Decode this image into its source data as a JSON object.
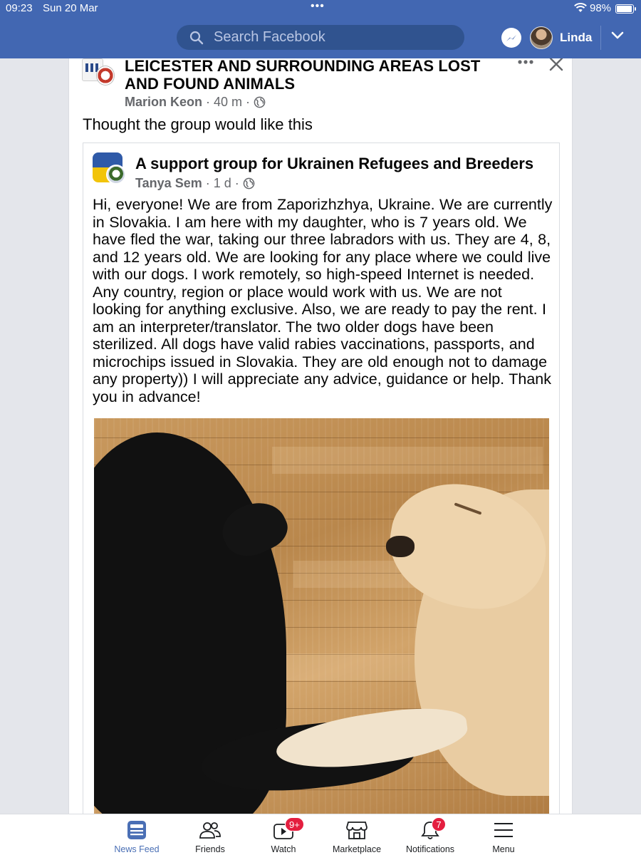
{
  "status_bar": {
    "time": "09:23",
    "date": "Sun 20 Mar",
    "battery_percent": "98%",
    "battery_level": 0.98
  },
  "header": {
    "search_placeholder": "Search Facebook",
    "user_name": "Linda",
    "brand_color": "#4267b2"
  },
  "post": {
    "group_name": "LEICESTER AND SURROUNDING AREAS LOST AND FOUND ANIMALS",
    "author": "Marion Keon",
    "time_ago": "40 m",
    "separator": "·",
    "caption": "Thought the group would like this",
    "shared": {
      "group_name": "A support group for Ukrainen Refugees and Breeders",
      "author": "Tanya Sem",
      "time_ago": "1 d",
      "text": "Hi, everyone! We are from Zaporizhzhya, Ukraine. We are currently in Slovakia. I am here with my daughter, who is 7 years old. We have fled the war, taking our three labradors with us. They are 4, 8, and 12 years old. We are looking for any place where we could live with our dogs. I work remotely, so high-speed Internet is needed. Any country, region or place would work with us. We are not looking for anything exclusive. Also, we are ready to pay the rent. I am an interpreter/translator. The two older dogs have been sterilized. All dogs have valid rabies vaccinations, passports, and microchips issued in Slovakia. They are old enough not to damage any property)) I will appreciate any advice, guidance or help. Thank you in advance!"
    }
  },
  "tabbar": {
    "tabs": [
      {
        "label": "News Feed",
        "icon": "news-feed-icon",
        "active": true
      },
      {
        "label": "Friends",
        "icon": "friends-icon"
      },
      {
        "label": "Watch",
        "icon": "watch-icon",
        "badge": "9+"
      },
      {
        "label": "Marketplace",
        "icon": "marketplace-icon"
      },
      {
        "label": "Notifications",
        "icon": "bell-icon",
        "badge": "7"
      },
      {
        "label": "Menu",
        "icon": "menu-icon"
      }
    ],
    "active_color": "#4a6fb5",
    "badge_color": "#e41e3f"
  }
}
